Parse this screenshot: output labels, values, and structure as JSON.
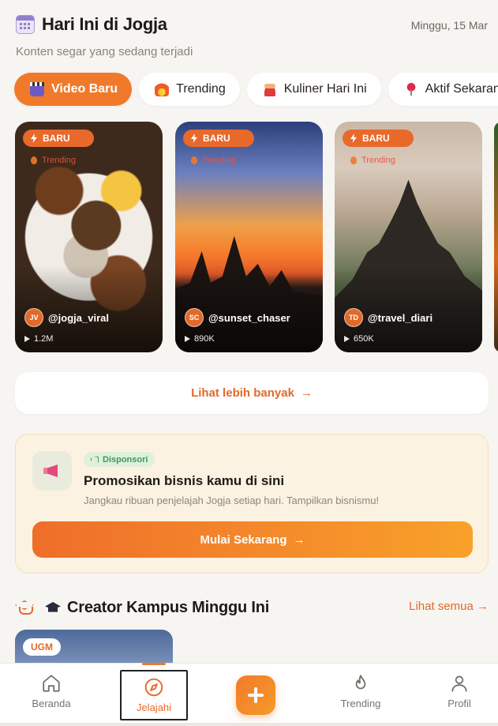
{
  "header": {
    "icon": "calendar-icon",
    "title": "Hari Ini di Jogja",
    "date": "Minggu, 15 Mar",
    "subtitle": "Konten segar yang sedang terjadi"
  },
  "chips": [
    {
      "label": "Video Baru",
      "icon": "clapper-icon",
      "active": true
    },
    {
      "label": "Trending",
      "icon": "fire-icon",
      "active": false
    },
    {
      "label": "Kuliner Hari Ini",
      "icon": "bowl-icon",
      "active": false
    },
    {
      "label": "Aktif Sekarang",
      "icon": "pin-icon",
      "active": false
    }
  ],
  "cards": [
    {
      "badge": "BARU",
      "trend": "Trending",
      "initials": "JV",
      "handle": "@jogja_viral",
      "views": "1.2M"
    },
    {
      "badge": "BARU",
      "trend": "Trending",
      "initials": "SC",
      "handle": "@sunset_chaser",
      "views": "890K"
    },
    {
      "badge": "BARU",
      "trend": "Trending",
      "initials": "TD",
      "handle": "@travel_diari",
      "views": "650K"
    }
  ],
  "more_button": {
    "label": "Lihat lebih banyak",
    "arrow": "→"
  },
  "promo": {
    "badge": "Disponsori",
    "title": "Promosikan bisnis kamu di sini",
    "description": "Jangkau ribuan penjelajah Jogja setiap hari. Tampilkan bisnismu!",
    "cta": "Mulai Sekarang",
    "arrow": "→"
  },
  "creator_section": {
    "title": "Creator Kampus Minggu Ini",
    "see_all": "Lihat semua →",
    "campus_tag": "UGM"
  },
  "bottom_nav": {
    "home": "Beranda",
    "explore": "Jelajahi",
    "trending": "Trending",
    "profile": "Profil"
  },
  "colors": {
    "accent": "#f07a2a",
    "background": "#f7f5f2"
  }
}
